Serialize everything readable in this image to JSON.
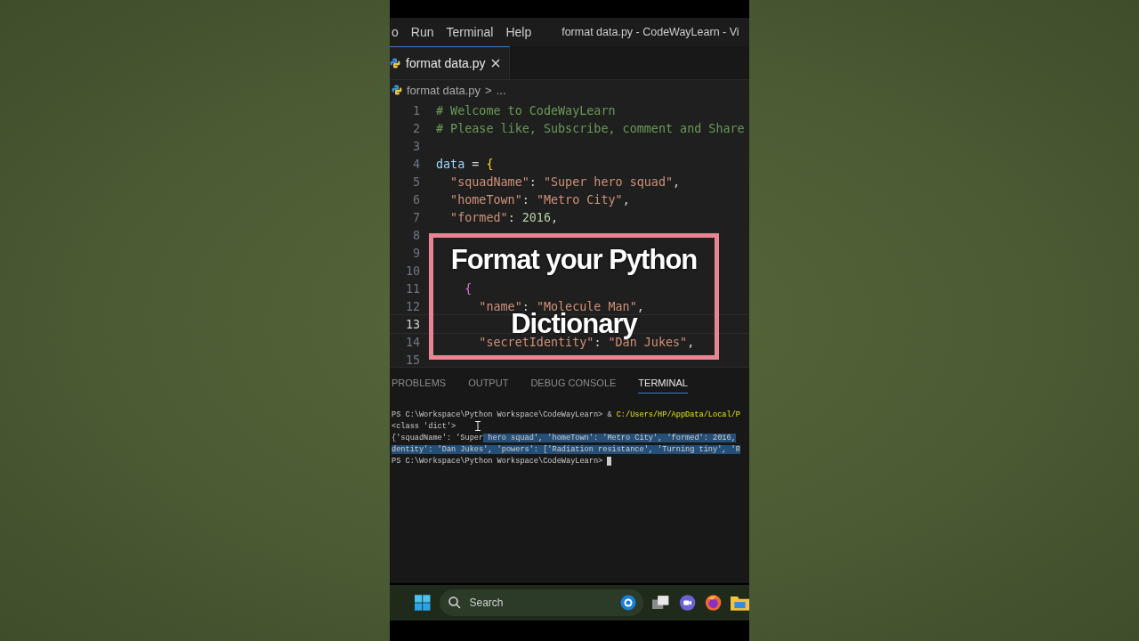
{
  "menu": {
    "items": [
      "o",
      "Run",
      "Terminal",
      "Help"
    ],
    "title": "format data.py - CodeWayLearn - Vi"
  },
  "tabs": [
    {
      "label": "format data.py",
      "selected": true
    }
  ],
  "breadcrumb": {
    "file": "format data.py",
    "separator": ">",
    "rest": "..."
  },
  "editor": {
    "lines": [
      {
        "number": "1",
        "current": false,
        "tokens": [
          {
            "text": "# Welcome to CodeWayLearn",
            "kind": "comment"
          }
        ]
      },
      {
        "number": "2",
        "current": false,
        "tokens": [
          {
            "text": "# Please like, Subscribe, comment and Share",
            "kind": "comment"
          }
        ]
      },
      {
        "number": "3",
        "current": false
      },
      {
        "number": "4",
        "current": false,
        "tokens": [
          {
            "text": "data",
            "kind": "var"
          },
          {
            "text": " = ",
            "kind": "punct"
          },
          {
            "text": "{",
            "kind": "brace"
          }
        ]
      },
      {
        "number": "5",
        "current": false,
        "tokens": [
          {
            "text": "  \"squadName\"",
            "kind": "string"
          },
          {
            "text": ": ",
            "kind": "punct"
          },
          {
            "text": "\"Super hero squad\"",
            "kind": "string"
          },
          {
            "text": ",",
            "kind": "punct"
          }
        ]
      },
      {
        "number": "6",
        "current": false,
        "tokens": [
          {
            "text": "  \"homeTown\"",
            "kind": "string"
          },
          {
            "text": ": ",
            "kind": "punct"
          },
          {
            "text": "\"Metro City\"",
            "kind": "string"
          },
          {
            "text": ",",
            "kind": "punct"
          }
        ]
      },
      {
        "number": "7",
        "current": false,
        "tokens": [
          {
            "text": "  \"formed\"",
            "kind": "string"
          },
          {
            "text": ": ",
            "kind": "punct"
          },
          {
            "text": "2016",
            "kind": "number"
          },
          {
            "text": ",",
            "kind": "punct"
          }
        ]
      },
      {
        "number": "8",
        "current": false
      },
      {
        "number": "9",
        "current": false
      },
      {
        "number": "10",
        "current": false
      },
      {
        "number": "11",
        "current": false,
        "tokens": [
          {
            "text": "    {",
            "kind": "brace2"
          }
        ]
      },
      {
        "number": "12",
        "current": false,
        "tokens": [
          {
            "text": "      \"name\"",
            "kind": "string"
          },
          {
            "text": ": ",
            "kind": "punct"
          },
          {
            "text": "\"Molecule Man\"",
            "kind": "string"
          },
          {
            "text": ",",
            "kind": "punct"
          }
        ]
      },
      {
        "number": "13",
        "current": true
      },
      {
        "number": "14",
        "current": false,
        "tokens": [
          {
            "text": "      \"secretIdentity\"",
            "kind": "string"
          },
          {
            "text": ": ",
            "kind": "punct"
          },
          {
            "text": "\"Dan Jukes\"",
            "kind": "string"
          },
          {
            "text": ",",
            "kind": "punct"
          }
        ]
      },
      {
        "number": "15",
        "current": false
      }
    ]
  },
  "overlay": {
    "lines": [
      "Format your Python",
      "Dictionary"
    ]
  },
  "panel": {
    "tabs": [
      {
        "label": "PROBLEMS",
        "selected": false
      },
      {
        "label": "OUTPUT",
        "selected": false
      },
      {
        "label": "DEBUG CONSOLE",
        "selected": false
      },
      {
        "label": "TERMINAL",
        "selected": true
      }
    ],
    "terminal": [
      {
        "segments": [
          {
            "text": "PS C:\\Workspace\\Python Workspace\\CodeWayLearn> & ",
            "kind": "plain",
            "selected": false
          },
          {
            "text": "C:/Users/HP/AppData/Local/P",
            "kind": "path",
            "selected": false
          }
        ]
      },
      {
        "segments": [
          {
            "text": "<class 'dict'>",
            "kind": "plain",
            "selected": false
          }
        ]
      },
      {
        "segments": [
          {
            "text": "{'squadName': 'Super",
            "kind": "plain",
            "selected": false
          },
          {
            "text": " hero squad', 'homeTown': 'Metro City', 'formed': 2016,",
            "kind": "plain",
            "selected": true
          }
        ]
      },
      {
        "segments": [
          {
            "text": "dentity': 'Dan Jukes', 'powers': ['Radiation resistance', 'Turning tiny', 'R",
            "kind": "plain",
            "selected": true
          }
        ]
      },
      {
        "segments": [
          {
            "text": "PS C:\\Workspace\\Python Workspace\\CodeWayLearn> ",
            "kind": "plain",
            "selected": false
          }
        ],
        "cursor": true
      }
    ]
  },
  "taskbar": {
    "search": {
      "placeholder": "Search"
    }
  }
}
